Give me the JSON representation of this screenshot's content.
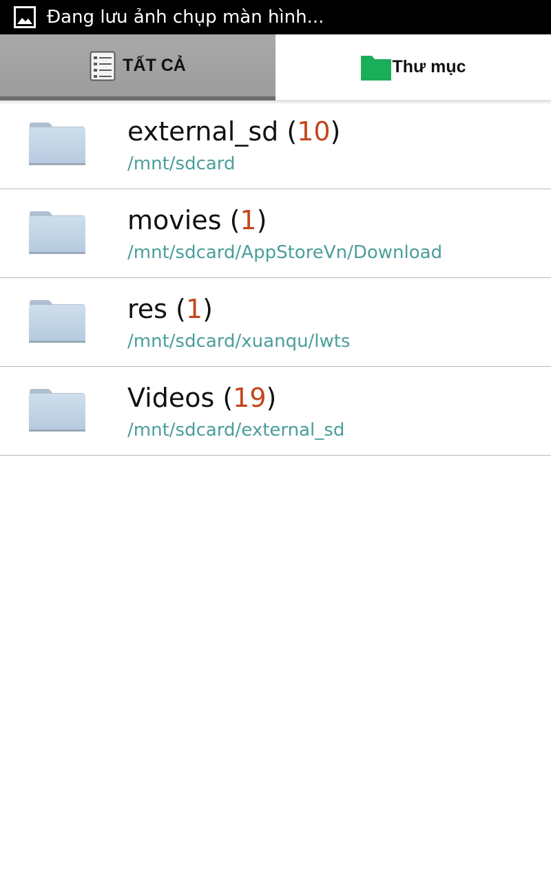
{
  "status_bar": {
    "icon": "image-icon",
    "text": "Đang lưu ảnh chụp màn hình..."
  },
  "tabs": [
    {
      "label": "TẤT CẢ",
      "icon": "list-icon",
      "selected": false
    },
    {
      "label": "Thư mục",
      "icon": "folder-icon",
      "selected": true,
      "icon_color": "#1aae5a"
    }
  ],
  "folders": [
    {
      "name": "external_sd",
      "count": "10",
      "path": "/mnt/sdcard"
    },
    {
      "name": "movies",
      "count": "1",
      "path": "/mnt/sdcard/AppStoreVn/Download"
    },
    {
      "name": "res",
      "count": "1",
      "path": "/mnt/sdcard/xuanqu/lwts"
    },
    {
      "name": "Videos",
      "count": "19",
      "path": "/mnt/sdcard/external_sd"
    }
  ],
  "colors": {
    "count": "#c1461b",
    "path": "#4a9e9a",
    "folder_tab_icon": "#1aae5a"
  }
}
